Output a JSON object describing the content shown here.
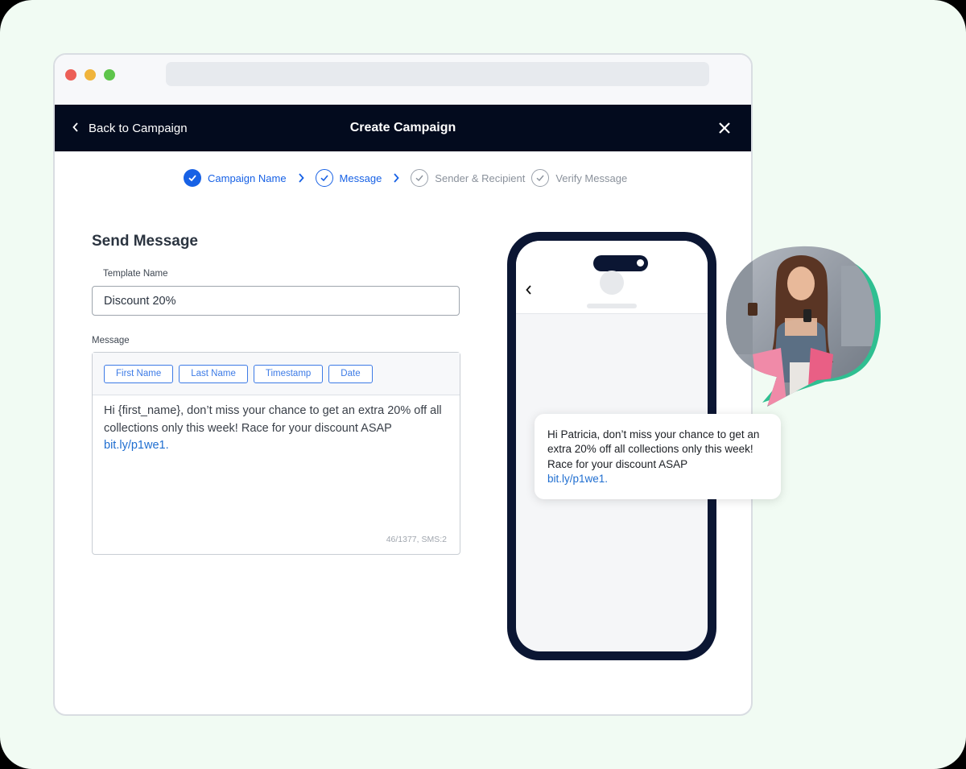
{
  "header": {
    "back_label": "Back to Campaign",
    "title": "Create Campaign"
  },
  "steps": [
    {
      "label": "Campaign Name",
      "state": "done"
    },
    {
      "label": "Message",
      "state": "active"
    },
    {
      "label": "Sender & Recipient",
      "state": "pending"
    },
    {
      "label": "Verify Message",
      "state": "pending"
    }
  ],
  "form": {
    "title": "Send Message",
    "template_label": "Template Name",
    "template_value": "Discount 20%",
    "message_label": "Message",
    "chips": [
      "First Name",
      "Last Name",
      "Timestamp",
      "Date"
    ],
    "message_text": "Hi {first_name}, don’t miss your chance to get an extra 20% off all collections only this week! Race for your discount ASAP",
    "message_link": "bit.ly/p1we1.",
    "counter": "46/1377, SMS:2"
  },
  "preview": {
    "text": "Hi Patricia, don’t miss your chance to get an extra 20% off all collections only this week! Race for your discount ASAP",
    "link": "bit.ly/p1we1."
  },
  "colors": {
    "accent": "#1761e5",
    "topbar": "#030b1e",
    "background": "#f1fbf3",
    "bubble_accent": "#2fbf91"
  }
}
